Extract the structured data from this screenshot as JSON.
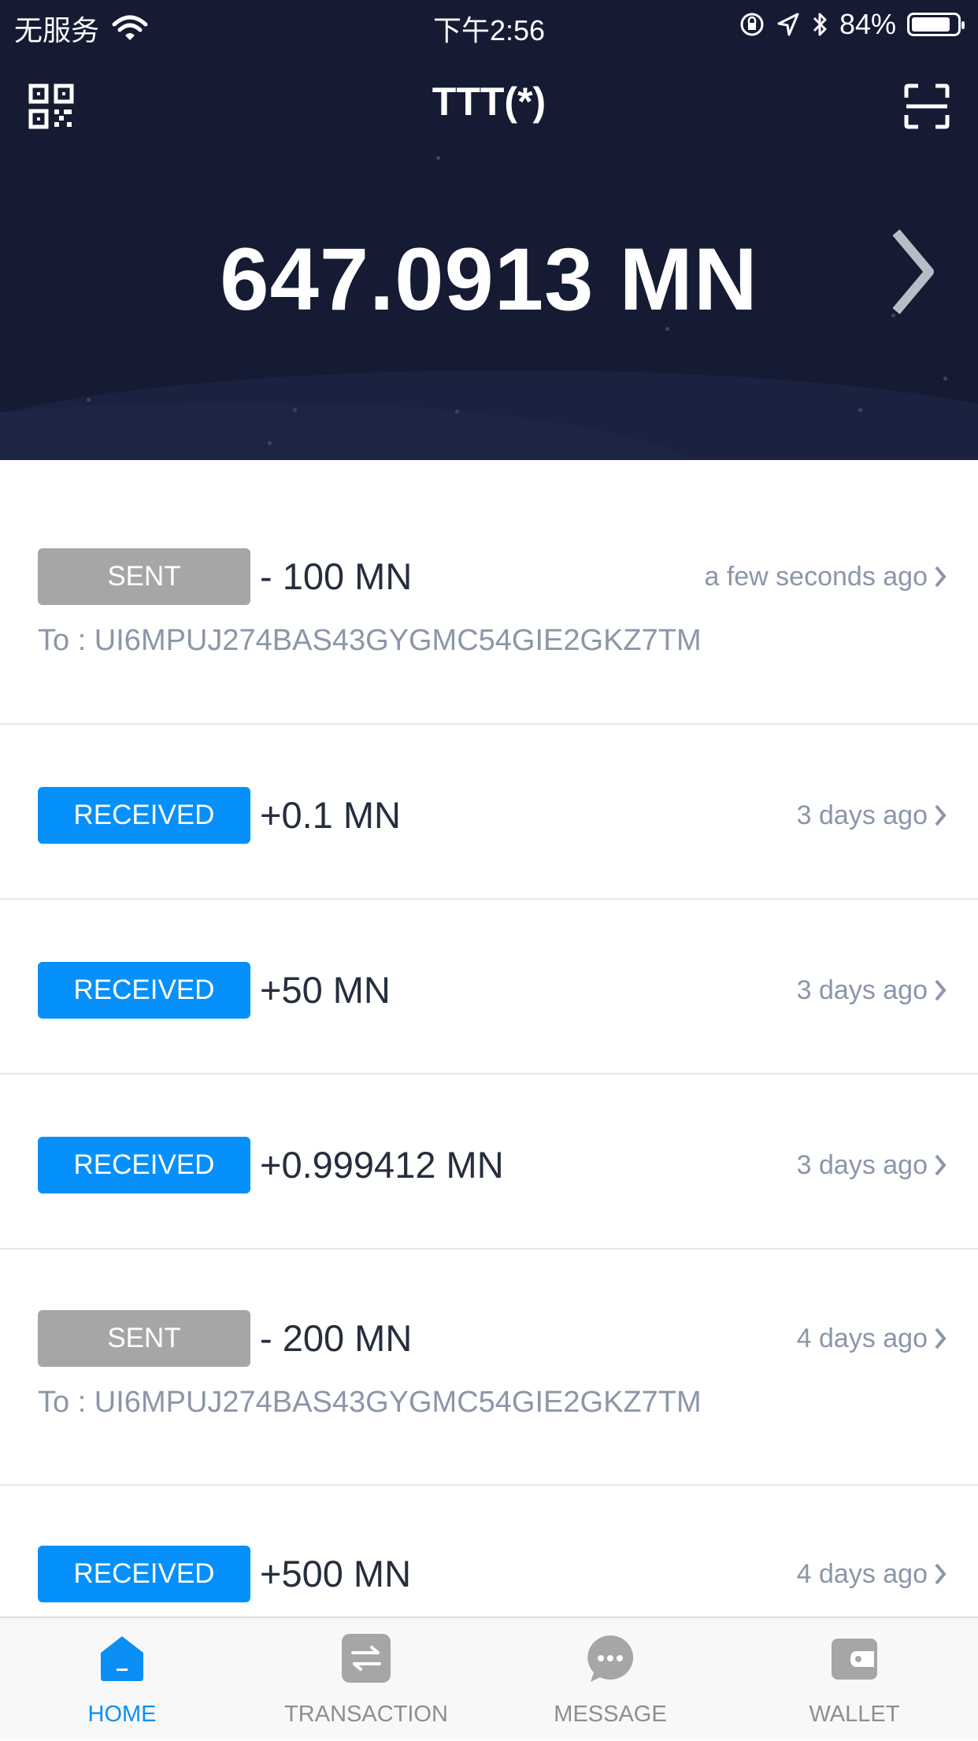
{
  "status_bar": {
    "carrier": "无服务",
    "time": "下午2:56",
    "battery": "84%",
    "battery_level": 0.84
  },
  "header": {
    "title": "TTT(*)",
    "balance": "647.0913 MN",
    "left_icon": "qr-code-icon",
    "right_icon": "scan-icon"
  },
  "transactions": [
    {
      "type": "SENT",
      "amount": "- 100 MN",
      "time": "a few seconds ago",
      "address": "To : UI6MPUJ274BAS43GYGMC54GIE2GKZ7TM"
    },
    {
      "type": "RECEIVED",
      "amount": "+0.1 MN",
      "time": "3 days ago"
    },
    {
      "type": "RECEIVED",
      "amount": "+50 MN",
      "time": "3 days ago"
    },
    {
      "type": "RECEIVED",
      "amount": "+0.999412 MN",
      "time": "3 days ago"
    },
    {
      "type": "SENT",
      "amount": "- 200 MN",
      "time": "4 days ago",
      "address": "To : UI6MPUJ274BAS43GYGMC54GIE2GKZ7TM"
    },
    {
      "type": "RECEIVED",
      "amount": "+500 MN",
      "time": "4 days ago"
    }
  ],
  "tabs": [
    {
      "label": "HOME",
      "icon": "home-icon",
      "active": true
    },
    {
      "label": "TRANSACTION",
      "icon": "transfer-icon",
      "active": false
    },
    {
      "label": "MESSAGE",
      "icon": "chat-bubble-icon",
      "active": false
    },
    {
      "label": "WALLET",
      "icon": "wallet-icon",
      "active": false
    }
  ],
  "colors": {
    "header_bg": "#141b33",
    "sent_badge": "#a6a6a6",
    "received_badge": "#0590fb",
    "active_tab": "#0a8ff6"
  }
}
